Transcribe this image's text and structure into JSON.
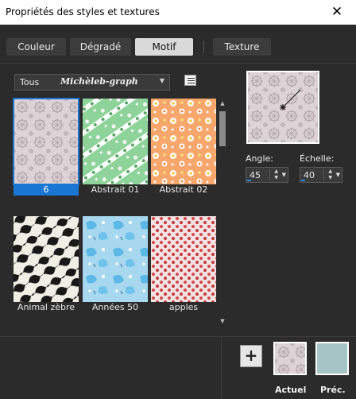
{
  "window": {
    "title": "Propriétés des styles et textures",
    "close_glyph": "✕"
  },
  "tabs": [
    {
      "label": "Couleur"
    },
    {
      "label": "Dégradé"
    },
    {
      "label": "Motif",
      "active": true
    },
    {
      "label": "Texture"
    }
  ],
  "category": {
    "scope": "Tous",
    "folder": "Michèleb-graph"
  },
  "patterns": [
    {
      "label": "6",
      "selected": true,
      "pattern": "lace-grey"
    },
    {
      "label": "Abstrait 01",
      "pattern": "green-diagonal-dots"
    },
    {
      "label": "Abstrait 02",
      "pattern": "orange-floral-dots"
    },
    {
      "label": "Animal zèbre",
      "pattern": "zebra-stripes"
    },
    {
      "label": "Années 50",
      "pattern": "blue-retro"
    },
    {
      "label": "apples",
      "pattern": "red-apples"
    }
  ],
  "transform": {
    "angle_label": "Angle:",
    "angle_value": "45",
    "scale_label": "Échelle:",
    "scale_value": "40"
  },
  "bottom": {
    "add_label": "+",
    "current_label": "Actuel",
    "previous_label": "Préc."
  },
  "colors": {
    "accent": "#1976d2",
    "background": "#2b2b2b",
    "previous_swatch": "#a6c3c5"
  },
  "icons": [
    "close-icon",
    "chevron-down-icon",
    "list-view-icon",
    "plus-icon",
    "spin-up-icon",
    "spin-down-icon",
    "scroll-up-icon",
    "scroll-down-icon"
  ]
}
